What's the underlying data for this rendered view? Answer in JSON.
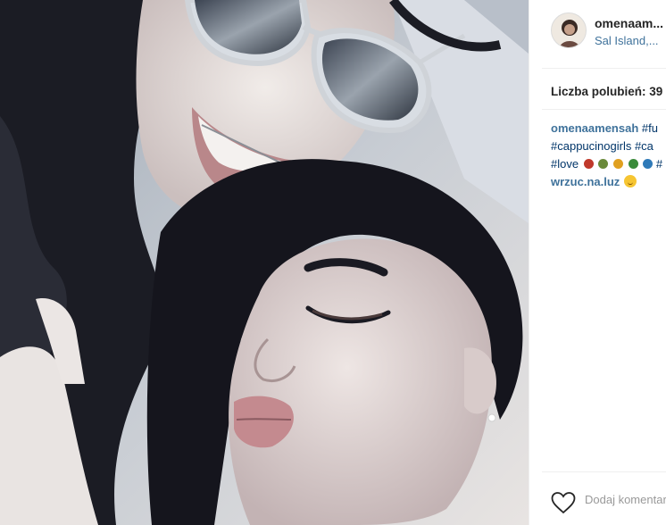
{
  "post": {
    "username": "omenaam...",
    "location": "Sal Island,..."
  },
  "likes": {
    "text": "Liczba polubień: 39"
  },
  "caption": {
    "username": "omenaamensah",
    "line1_tags": "#fu",
    "line2": "#cappucinogirls #ca",
    "line3_tags_a": "#love",
    "line3_tags_b": "#"
  },
  "comment": {
    "username": "wrzuc.na.luz"
  },
  "add_comment": {
    "placeholder": "Dodaj komentarz..."
  },
  "icons": {
    "like": "heart-outline-icon",
    "emoji": "smiley-emoji-icon"
  }
}
